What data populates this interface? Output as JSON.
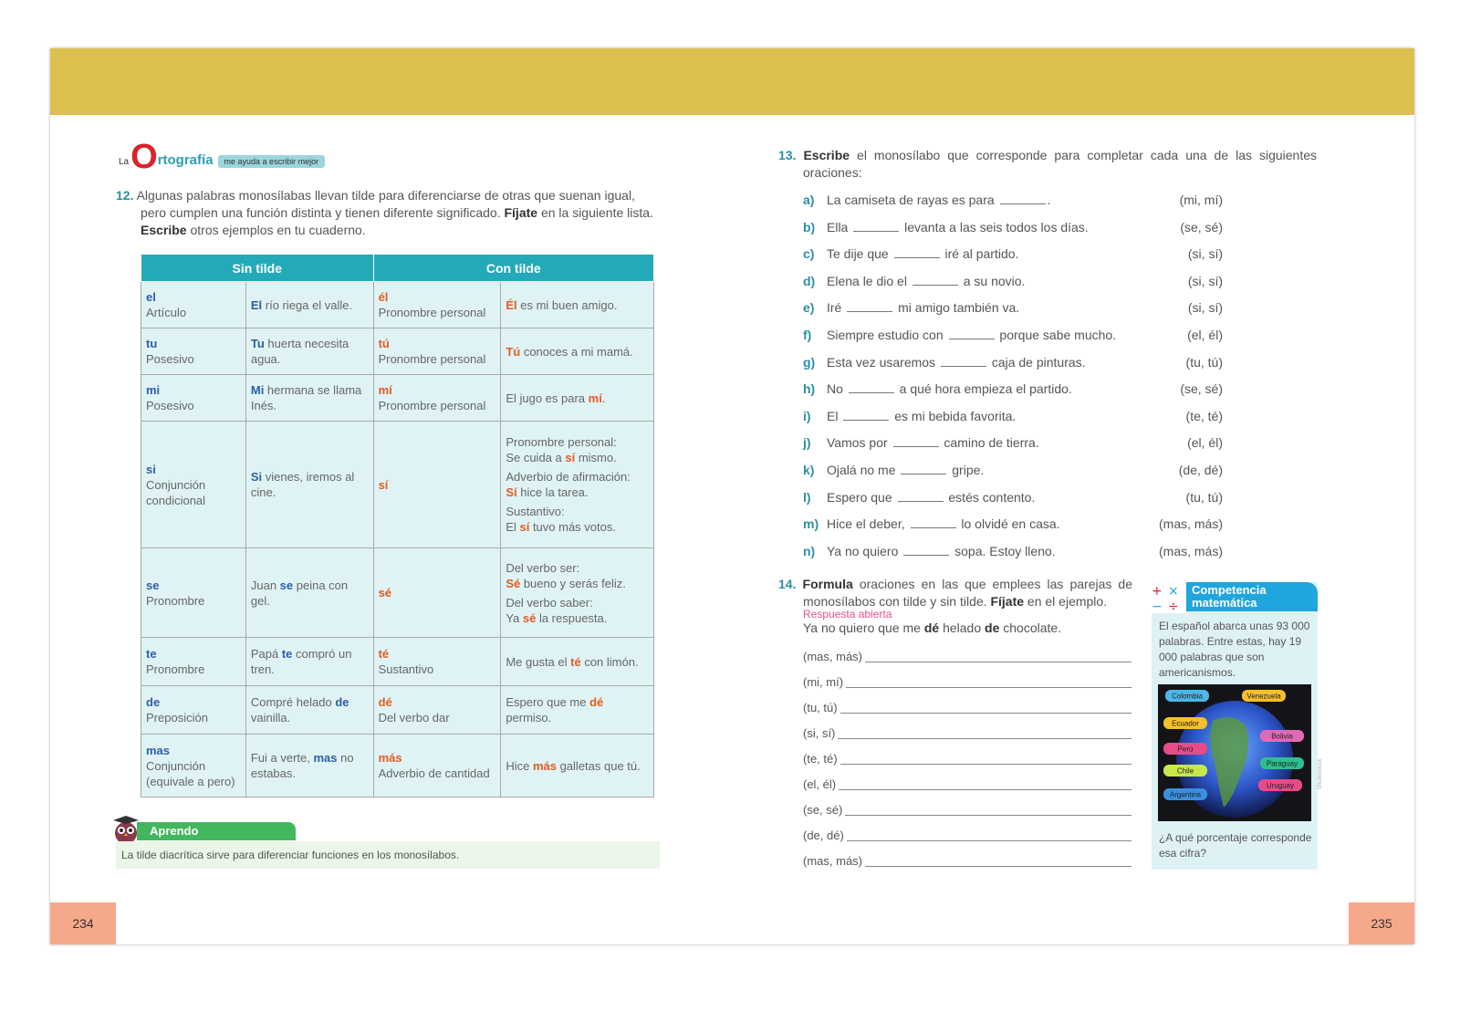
{
  "left_page": {
    "brand": {
      "la": "La",
      "o": "O",
      "rest": "rtografía",
      "tag": "me ayuda a escribir mejor"
    },
    "exercise12": {
      "number": "12.",
      "text_1": "Algunas palabras monosílabas llevan tilde para diferenciarse de otras que suenan igual, pero cumplen una función distinta y tienen diferente significado. ",
      "bold_1": "Fíjate",
      "text_2": " en la siguiente lista. ",
      "bold_2": "Escribe",
      "text_3": " otros ejemplos en tu cuaderno."
    },
    "table": {
      "header_left": "Sin tilde",
      "header_right": "Con tilde",
      "rows": [
        {
          "w1": "el",
          "c1": "Artículo",
          "e1a": "El",
          "e1b": " río riega el valle.",
          "w2": "él",
          "c2": "Pronombre personal",
          "e2a": "Él",
          "e2b": " es mi buen amigo."
        },
        {
          "w1": "tu",
          "c1": "Posesivo",
          "e1a": "Tu",
          "e1b": " huerta necesita agua.",
          "w2": "tú",
          "c2": "Pronombre personal",
          "e2a": "Tú",
          "e2b": " conoces a mi mamá."
        },
        {
          "w1": "mi",
          "c1": "Posesivo",
          "e1a": "Mi",
          "e1b": " hermana se llama Inés.",
          "w2": "mí",
          "c2": "Pronombre personal",
          "e2pre": "El jugo es para ",
          "e2a": "mí",
          "e2b": "."
        },
        {
          "w1": "si",
          "c1": "Conjunción condicional",
          "e1a": "Si",
          "e1b": " vienes, iremos al cine.",
          "w2": "sí",
          "e2_parts": [
            {
              "lead": "Pronombre personal:",
              "pre": "Se cuida a ",
              "kw": "sí",
              "post": " mismo."
            },
            {
              "lead": "Adverbio de afirmación:",
              "pre": "",
              "kw": "Sí",
              "post": " hice la tarea."
            },
            {
              "lead": "Sustantivo:",
              "pre": "El ",
              "kw": "sí",
              "post": " tuvo más votos."
            }
          ]
        },
        {
          "w1": "se",
          "c1": "Pronombre",
          "e1pre": "Juan ",
          "e1a": "se",
          "e1b": " peina con gel.",
          "w2": "sé",
          "e2_parts": [
            {
              "lead": "Del verbo ser:",
              "pre": "",
              "kw": "Sé",
              "post": " bueno y serás feliz."
            },
            {
              "lead": "Del verbo saber:",
              "pre": "Ya ",
              "kw": "sé",
              "post": " la respuesta."
            }
          ]
        },
        {
          "w1": "te",
          "c1": "Pronombre",
          "e1pre": "Papá ",
          "e1a": "te",
          "e1b": " compró un tren.",
          "w2": "té",
          "c2": "Sustantivo",
          "e2pre": "Me gusta el ",
          "e2a": "té",
          "e2b": " con limón."
        },
        {
          "w1": "de",
          "c1": "Preposición",
          "e1pre": "Compré helado ",
          "e1a": "de",
          "e1b": " vainilla.",
          "w2": "dé",
          "c2": "Del verbo dar",
          "e2pre": "Espero que me ",
          "e2a": "dé",
          "e2b": " permiso."
        },
        {
          "w1": "mas",
          "c1": "Conjunción (equivale a pero)",
          "e1pre": "Fui a verte, ",
          "e1a": "mas",
          "e1b": " no estabas.",
          "w2": "más",
          "c2": "Adverbio de cantidad",
          "e2pre": "Hice ",
          "e2a": "más",
          "e2b": " galletas que tú."
        }
      ]
    },
    "aprendo": {
      "title": "Aprendo",
      "text": "La tilde diacrítica sirve para diferenciar funciones en los monosílabos."
    },
    "page_number": "234"
  },
  "right_page": {
    "exercise13": {
      "number": "13.",
      "bold": "Escribe",
      "text": " el monosílabo que corresponde para completar cada una de las siguientes oraciones:",
      "items": [
        {
          "letter": "a)",
          "before": "La camiseta de rayas es para ",
          "after": ".",
          "options": "(mi, mí)"
        },
        {
          "letter": "b)",
          "before": "Ella ",
          "after": " levanta a las seis todos los días.",
          "options": "(se, sé)"
        },
        {
          "letter": "c)",
          "before": "Te dije que ",
          "after": " iré al partido.",
          "options": "(si, sí)"
        },
        {
          "letter": "d)",
          "before": "Elena le dio el ",
          "after": " a su novio.",
          "options": "(si, sí)"
        },
        {
          "letter": "e)",
          "before": "Iré ",
          "after": " mi amigo también va.",
          "options": "(si, sí)"
        },
        {
          "letter": "f)",
          "before": "Siempre estudio con ",
          "after": " porque sabe mucho.",
          "options": "(el, él)"
        },
        {
          "letter": "g)",
          "before": "Esta vez usaremos ",
          "after": " caja de pinturas.",
          "options": "(tu, tú)"
        },
        {
          "letter": "h)",
          "before": "No ",
          "after": " a qué hora empieza el partido.",
          "options": "(se, sé)"
        },
        {
          "letter": "i)",
          "before": "El ",
          "after": " es mi bebida favorita.",
          "options": "(te, té)"
        },
        {
          "letter": "j)",
          "before": "Vamos por ",
          "after": " camino de tierra.",
          "options": "(el, él)"
        },
        {
          "letter": "k)",
          "before": "Ojalá no me ",
          "after": " gripe.",
          "options": "(de, dé)"
        },
        {
          "letter": "l)",
          "before": "Espero que ",
          "after": " estés contento.",
          "options": "(tu, tú)"
        },
        {
          "letter": "m)",
          "before": "Hice el deber, ",
          "after": " lo olvidé en casa.",
          "options": "(mas, más)"
        },
        {
          "letter": "n)",
          "before": "Ya no quiero ",
          "after": " sopa. Estoy lleno.",
          "options": "(mas, más)"
        }
      ]
    },
    "exercise14": {
      "number": "14.",
      "bold_1": "Formula",
      "text_1": " oraciones en las que emplees las parejas de monosílabos con tilde y sin tilde. ",
      "bold_2": "Fíjate",
      "text_2": " en el ejemplo.",
      "answer_note": "Respuesta abierta",
      "example_pre": "Ya no quiero que me ",
      "example_b1": "dé",
      "example_mid": " helado ",
      "example_b2": "de",
      "example_post": " chocolate.",
      "pairs": [
        "(mas, más)",
        "(mi, mí)",
        "(tu, tú)",
        "(si, sí)",
        "(te, té)",
        "(el, él)",
        "(se, sé)",
        "(de, dé)",
        "(mas, más)"
      ]
    },
    "competencia": {
      "title": "Competencia matemática",
      "text": "El español abarca unas 93 000 palabras. Entre estas, hay 19 000 palabras que son americanismos.",
      "countries": [
        "Colombia",
        "Venezuela",
        "Ecuador",
        "Bolivia",
        "Perú",
        "Paraguay",
        "Chile",
        "Uruguay",
        "Argentina"
      ],
      "question": "¿A qué porcentaje corresponde esa cifra?"
    },
    "side_text": "Shutterstock",
    "page_number": "235"
  },
  "colors": {
    "band": "#dcbf4f",
    "teal": "#24a9b9",
    "table_bg": "#dff3f5",
    "keyword_blue": "#2d5ea8",
    "keyword_red": "#e35c1f",
    "page_tab": "#f6a98a",
    "green": "#43b75e"
  }
}
